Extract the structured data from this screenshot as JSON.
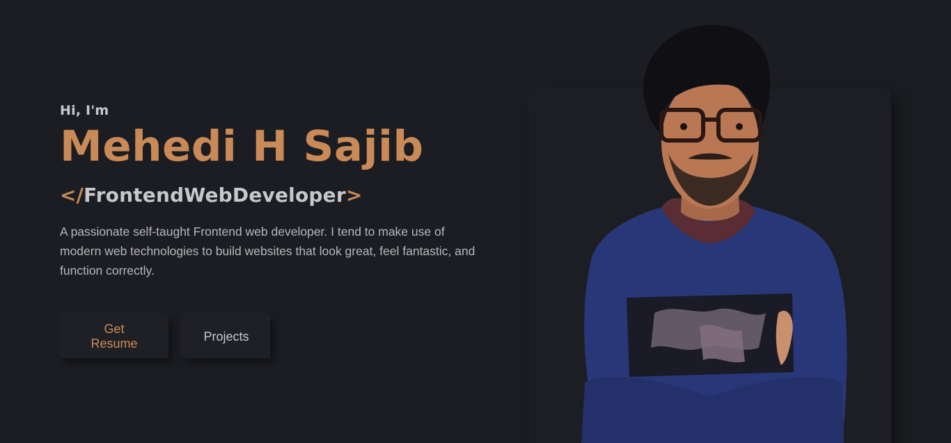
{
  "hero": {
    "greeting": "Hi, I'm",
    "name": "Mehedi H Sajib",
    "role": {
      "open": "</",
      "title": "FrontendWebDeveloper",
      "close": ">"
    },
    "bio": "A passionate self-taught Frontend web developer. I tend to make use of modern web technologies to build websites that look great, feel fantastic, and function correctly.",
    "buttons": {
      "resume": "Get Resume",
      "projects": "Projects"
    }
  },
  "colors": {
    "background": "#1c1d22",
    "accent": "#c98a57",
    "text": "#c7c8cc"
  },
  "portrait": {
    "subject": "person-portrait"
  }
}
